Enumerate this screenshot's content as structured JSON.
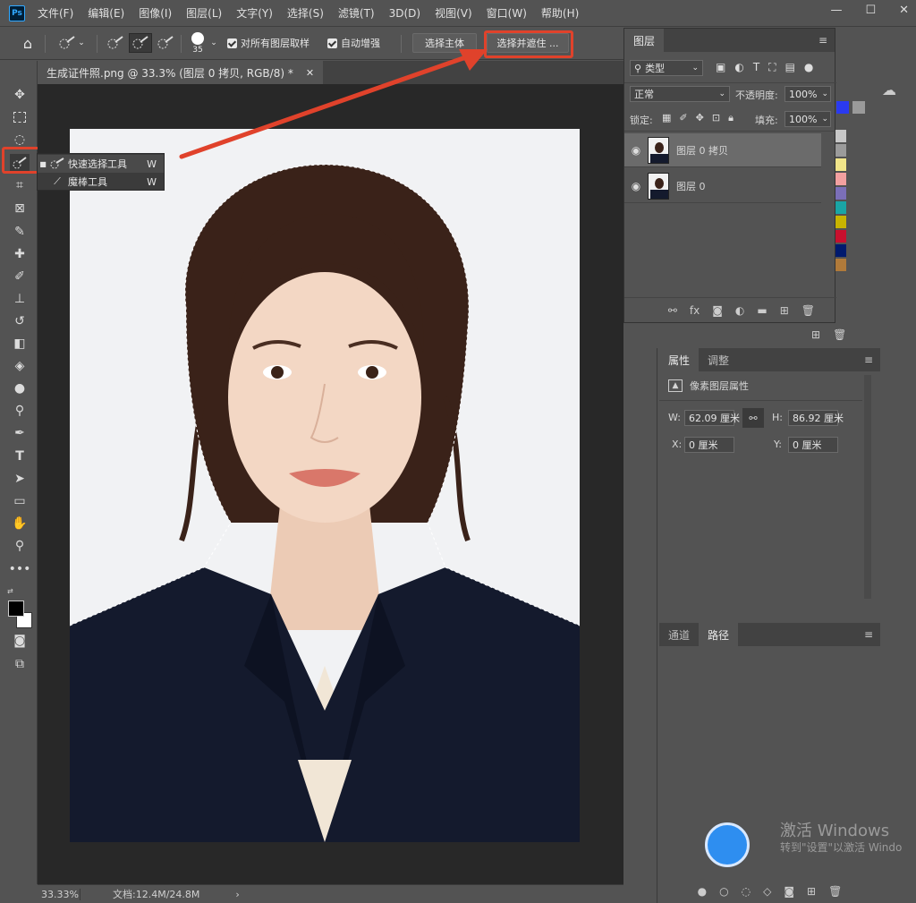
{
  "menubar": {
    "logo": "Ps",
    "items": [
      "文件(F)",
      "编辑(E)",
      "图像(I)",
      "图层(L)",
      "文字(Y)",
      "选择(S)",
      "滤镜(T)",
      "3D(D)",
      "视图(V)",
      "窗口(W)",
      "帮助(H)"
    ]
  },
  "options": {
    "brush_size": "35",
    "sample_all_label": "对所有图层取样",
    "auto_enhance_label": "自动增强",
    "select_subject_label": "选择主体",
    "select_mask_label": "选择并遮住 ..."
  },
  "document": {
    "tab_title": "生成证件照.png @ 33.3% (图层 0 拷贝, RGB/8) *",
    "zoom": "33.33%",
    "doc_info": "文档:12.4M/24.8M"
  },
  "flyout": {
    "items": [
      {
        "label": "快速选择工具",
        "shortcut": "W"
      },
      {
        "label": "魔棒工具",
        "shortcut": "W"
      }
    ]
  },
  "layers_panel": {
    "tab": "图层",
    "filter_label": "类型",
    "blend_mode": "正常",
    "opacity_label": "不透明度:",
    "opacity_value": "100%",
    "lock_label": "锁定:",
    "fill_label": "填充:",
    "fill_value": "100%",
    "layers": [
      {
        "name": "图层 0 拷贝",
        "selected": true
      },
      {
        "name": "图层 0",
        "selected": false
      }
    ]
  },
  "properties_panel": {
    "tabs": [
      "属性",
      "调整"
    ],
    "title": "像素图层属性",
    "w_label": "W:",
    "w_value": "62.09 厘米",
    "h_label": "H:",
    "h_value": "86.92 厘米",
    "x_label": "X:",
    "x_value": "0 厘米",
    "y_label": "Y:",
    "y_value": "0 厘米"
  },
  "channels_panel": {
    "tabs": [
      "通道",
      "路径"
    ]
  },
  "watermark": {
    "line1": "激活 Windows",
    "line2": "转到\"设置\"以激活 Windo"
  },
  "colors": {
    "accent_red": "#e0422b",
    "foreground": "#000000",
    "background": "#ffffff",
    "swatches": [
      "#c8c8c8",
      "#9b9b9b",
      "#f1e58a",
      "#f2a0a0",
      "#7b6fb8",
      "#1aa5a5",
      "#c8b400",
      "#c8102e",
      "#001a6e",
      "#b07a3a"
    ]
  }
}
